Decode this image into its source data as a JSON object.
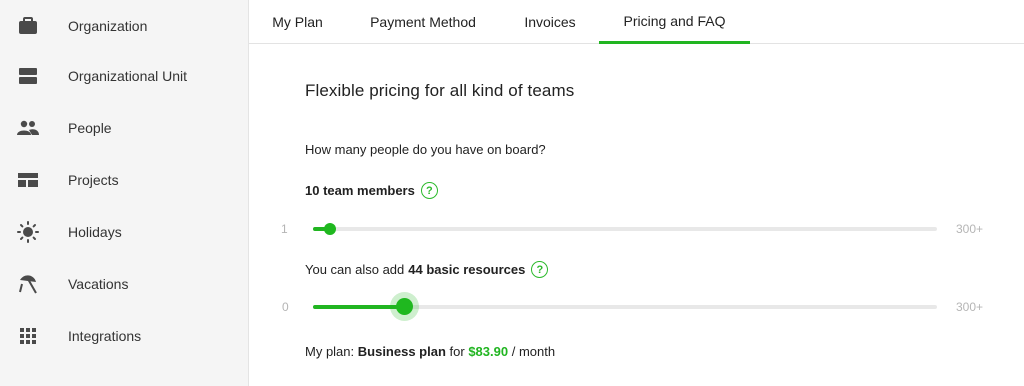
{
  "sidebar": {
    "items": [
      {
        "label": "Organization",
        "icon": "briefcase-icon"
      },
      {
        "label": "Organizational Unit",
        "icon": "server-icon"
      },
      {
        "label": "People",
        "icon": "people-icon"
      },
      {
        "label": "Projects",
        "icon": "projects-icon"
      },
      {
        "label": "Holidays",
        "icon": "sun-icon"
      },
      {
        "label": "Vacations",
        "icon": "beach-umbrella-icon"
      },
      {
        "label": "Integrations",
        "icon": "grid-icon"
      }
    ]
  },
  "tabs": [
    {
      "label": "My Plan"
    },
    {
      "label": "Payment Method"
    },
    {
      "label": "Invoices"
    },
    {
      "label": "Pricing and FAQ",
      "active": true
    }
  ],
  "pricing": {
    "heading": "Flexible pricing for all kind of teams",
    "question": "How many people do you have on board?",
    "members_text": "10 team members",
    "members_help": "?",
    "members_slider": {
      "min_label": "1",
      "max_label": "300+",
      "value": 10,
      "min": 1,
      "max": 300
    },
    "resources_prefix": "You can also add",
    "resources_bold": "44 basic resources",
    "resources_help": "?",
    "resources_slider": {
      "min_label": "0",
      "max_label": "300+",
      "value": 44,
      "min": 0,
      "max": 300
    },
    "plan_prefix": "My plan:",
    "plan_name": "Business plan",
    "plan_for": "for",
    "plan_price": "$83.90",
    "plan_period": "/ month"
  },
  "colors": {
    "accent": "#21b521",
    "sidebar_bg": "#f5f5f5",
    "track": "#e8e8e8"
  }
}
